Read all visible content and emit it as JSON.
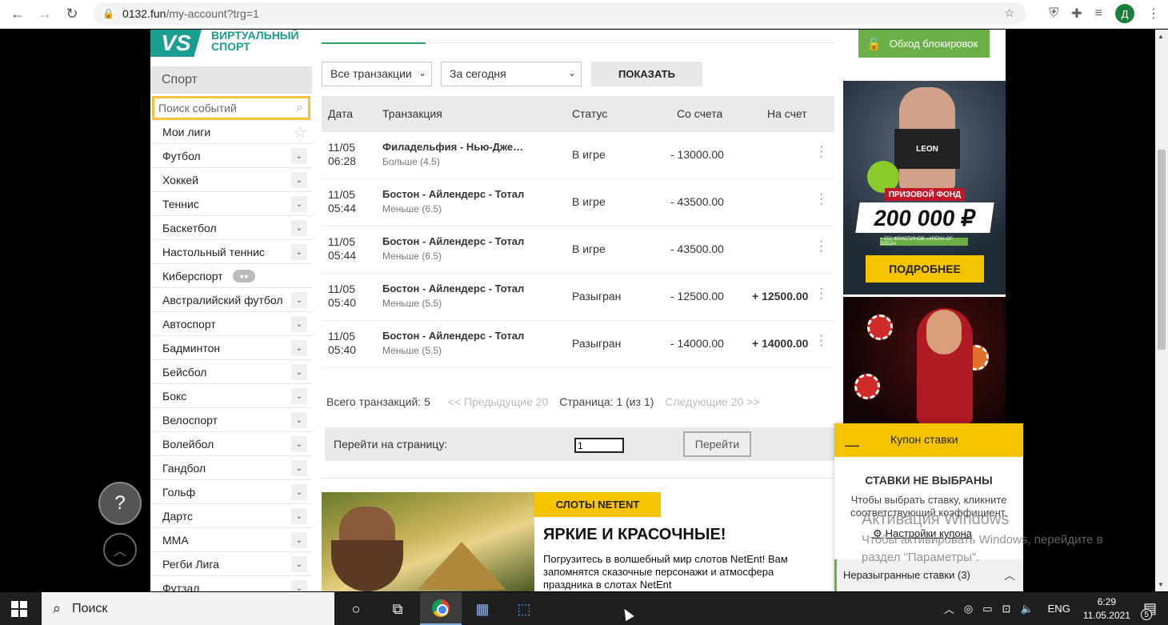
{
  "browser": {
    "url_host": "0132.fun",
    "url_path": "/my-account?trg=1",
    "profile_initial": "Д"
  },
  "logo": {
    "mark": "VS",
    "line1": "ВИРТУАЛЬНЫЙ",
    "line2": "СПОРТ"
  },
  "sidebar": {
    "heading": "Спорт",
    "search_placeholder": "Поиск событий",
    "items": [
      {
        "label": "Мои лиги",
        "icon": "star-icon"
      },
      {
        "label": "Футбол"
      },
      {
        "label": "Хоккей"
      },
      {
        "label": "Теннис"
      },
      {
        "label": "Баскетбол"
      },
      {
        "label": "Настольный теннис"
      },
      {
        "label": "Киберспорт",
        "icon": "gamepad-icon"
      },
      {
        "label": "Австралийский футбол"
      },
      {
        "label": "Автоспорт"
      },
      {
        "label": "Бадминтон"
      },
      {
        "label": "Бейсбол"
      },
      {
        "label": "Бокс"
      },
      {
        "label": "Велоспорт"
      },
      {
        "label": "Волейбол"
      },
      {
        "label": "Гандбол"
      },
      {
        "label": "Гольф"
      },
      {
        "label": "Дартс"
      },
      {
        "label": "ММА"
      },
      {
        "label": "Регби Лига"
      },
      {
        "label": "Футзал"
      }
    ]
  },
  "filters": {
    "type": "Все транзакции",
    "period": "За сегодня",
    "show_label": "ПОКАЗАТЬ"
  },
  "table": {
    "headers": {
      "date": "Дата",
      "tx": "Транзакция",
      "status": "Статус",
      "from": "Со счета",
      "to": "На счет"
    },
    "rows": [
      {
        "date": "11/05",
        "time": "06:28",
        "title": "Филадельфия - Нью-Дже…",
        "sub": "Больше (4.5)",
        "status": "В игре",
        "from": "- 13000.00",
        "to": ""
      },
      {
        "date": "11/05",
        "time": "05:44",
        "title": "Бостон - Айлендерс - Тотал",
        "sub": "Меньше (6.5)",
        "status": "В игре",
        "from": "- 43500.00",
        "to": ""
      },
      {
        "date": "11/05",
        "time": "05:44",
        "title": "Бостон - Айлендерс - Тотал",
        "sub": "Меньше (6.5)",
        "status": "В игре",
        "from": "- 43500.00",
        "to": ""
      },
      {
        "date": "11/05",
        "time": "05:40",
        "title": "Бостон - Айлендерс - Тотал",
        "sub": "Меньше (5.5)",
        "status": "Разыгран",
        "from": "- 12500.00",
        "to": "+ 12500.00"
      },
      {
        "date": "11/05",
        "time": "05:40",
        "title": "Бостон - Айлендерс - Тотал",
        "sub": "Меньше (5.5)",
        "status": "Разыгран",
        "from": "- 14000.00",
        "to": "+ 14000.00"
      }
    ]
  },
  "pager": {
    "total": "Всего транзакций: 5",
    "prev": "<< Предыдущие 20",
    "page": "Страница: 1 (из 1)",
    "next": "Следующие 20 >>"
  },
  "goto": {
    "label": "Перейти на страницу:",
    "value": "1",
    "button": "Перейти"
  },
  "promo": {
    "badge": "СЛОТЫ NETENT",
    "heading": "ЯРКИЕ И КРАСОЧНЫЕ!",
    "text": "Погрузитесь в волшебный мир слотов NetEnt! Вам запомнятся сказочные персонажи и атмосфера праздника в слотах NetEnt"
  },
  "right": {
    "unblock": "Обход блокировок",
    "banner1": {
      "logo": "LEON",
      "fund": "ПРИЗОВОЙ ФОНД",
      "amount": "200 000 ₽",
      "small": "+ 550 ФРИСПИНОВ «ARENA OF GOLD»",
      "more": "ПОДРОБНЕЕ"
    }
  },
  "coupon": {
    "title": "Купон ставки",
    "minimize": "—",
    "empty": "СТАВКИ НЕ ВЫБРАНЫ",
    "hint": "Чтобы выбрать ставку, кликните соответствующий коэффициент.",
    "settings": "Настройки купона",
    "unplayed": "Неразыгранные ставки (3)"
  },
  "windows_watermark": {
    "line1": "Активация Windows",
    "line2": "Чтобы активировать Windows, перейдите в раздел \"Параметры\"."
  },
  "taskbar": {
    "search": "Поиск",
    "lang": "ENG",
    "time": "6:29",
    "date": "11.05.2021",
    "notifications": "5"
  }
}
